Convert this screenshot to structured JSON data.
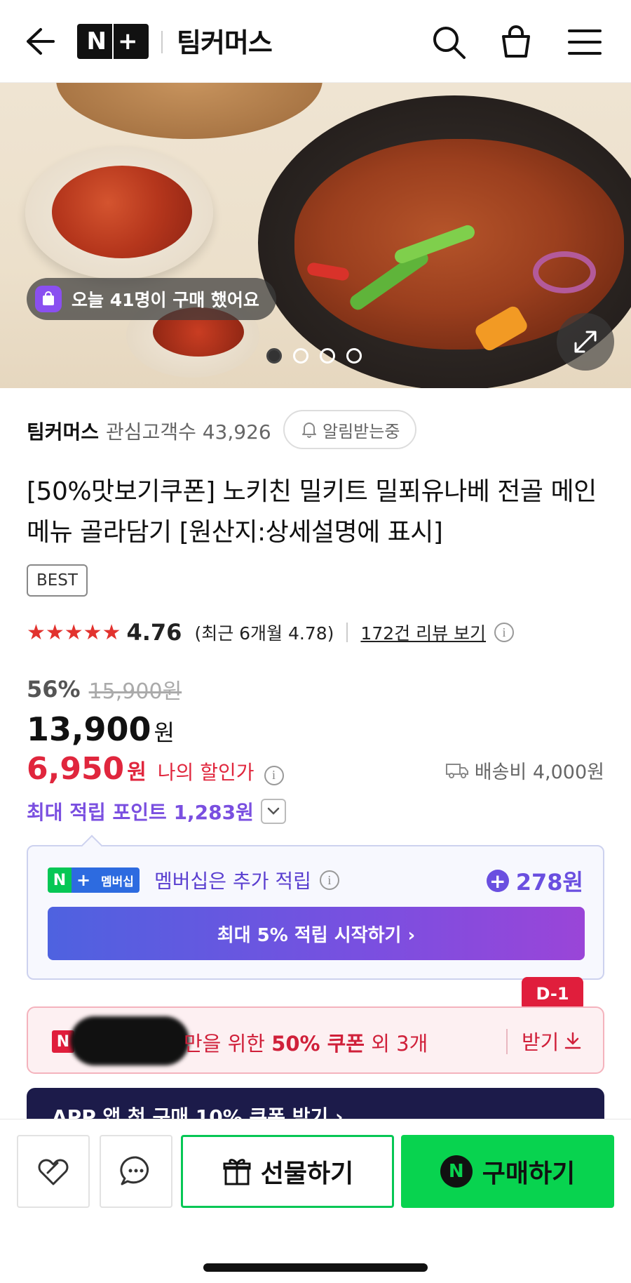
{
  "header": {
    "brand_badge": "N+",
    "store_name": "팀커머스"
  },
  "hero": {
    "purchase_badge": "오늘 41명이 구매 했어요",
    "slide_count": 4,
    "active_slide": 1
  },
  "seller": {
    "name": "팀커머스",
    "fans_label": "관심고객수 43,926",
    "notify_label": "알림받는중"
  },
  "product": {
    "title": "[50%맛보기쿠폰] 노키친 밀키트 밀푀유나베 전골 메인메뉴 골라담기 [원산지:상세설명에 표시]",
    "tag": "BEST"
  },
  "rating": {
    "stars": "★★★★★",
    "score": "4.76",
    "recent": "(최근 6개월 4.78)",
    "reviews_link": "172건 리뷰 보기"
  },
  "price": {
    "discount": "56%",
    "original": "15,900원",
    "sale_number": "13,900",
    "sale_unit": "원",
    "my_number": "6,950",
    "my_unit": "원",
    "my_label": "나의 할인가",
    "shipping": "배송비 4,000원",
    "points": "최대 적립 포인트 1,283원"
  },
  "membership": {
    "badge_n": "N",
    "badge_plus": "+",
    "badge_text": "멤버십",
    "text": "멤버십은 추가 적립",
    "extra_points": "278원",
    "start_button": "최대 5% 적립 시작하기 ›"
  },
  "coupon": {
    "dday": "D-1",
    "n_logo": "N",
    "text_prefix": "만을 위한 ",
    "text_bold": "50% 쿠폰",
    "text_suffix": " 외 3개",
    "get_label": "받기"
  },
  "app_banner": {
    "text": "APP 앱 첫 구매 10% 쿠폰 받기 ›"
  },
  "bottom_bar": {
    "gift_label": "선물하기",
    "buy_label": "구매하기",
    "buy_n": "N"
  },
  "colors": {
    "naver_green": "#06c755",
    "sale_red": "#e0263d",
    "point_purple": "#7a4fe0",
    "star_red": "#e2322e"
  }
}
